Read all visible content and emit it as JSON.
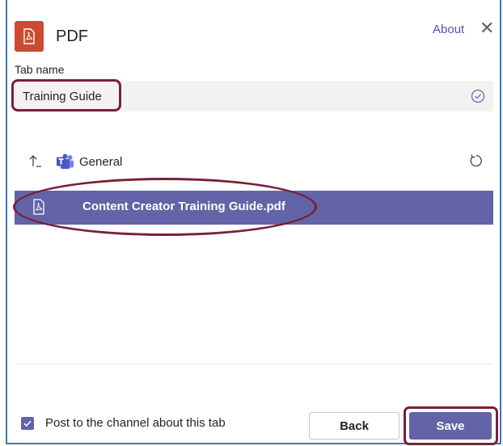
{
  "header": {
    "app_title": "PDF",
    "about_label": "About",
    "close_symbol": "✕"
  },
  "tab_name": {
    "label": "Tab name",
    "value": "Training Guide"
  },
  "browser": {
    "breadcrumb": "General",
    "files": [
      {
        "name": "Content Creator Training Guide.pdf",
        "selected": true
      }
    ]
  },
  "footer": {
    "post_label": "Post to the channel about this tab",
    "post_checked": true,
    "back_label": "Back",
    "save_label": "Save"
  },
  "colors": {
    "accent": "#6264a7",
    "app_icon": "#cc4a31",
    "annotation": "#7b1f3a",
    "link": "#4f52b2"
  },
  "icons": [
    "pdf-icon",
    "close-icon",
    "check-circle-icon",
    "up-arrow-icon",
    "teams-icon",
    "refresh-icon",
    "checkmark-icon"
  ]
}
